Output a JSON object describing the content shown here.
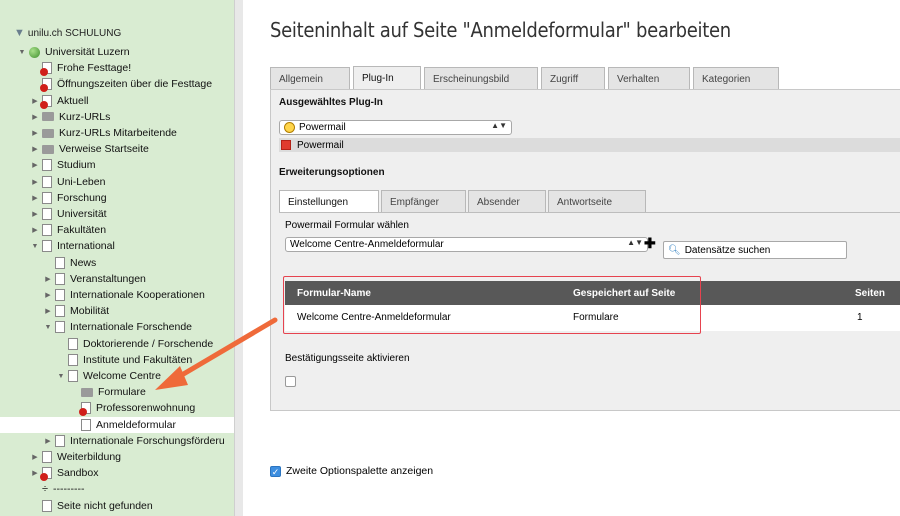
{
  "tree": {
    "site": "unilu.ch SCHULUNG",
    "items": [
      {
        "label": "Universität Luzern",
        "indent": 0,
        "icon": "globe-icon",
        "toggle": "▼"
      },
      {
        "label": "Frohe Festtage!",
        "indent": 1,
        "icon": "page-restricted-icon",
        "toggle": ""
      },
      {
        "label": "Öffnungszeiten über die Festtage",
        "indent": 1,
        "icon": "page-restricted-icon",
        "toggle": ""
      },
      {
        "label": "Aktuell",
        "indent": 1,
        "icon": "page-restricted-icon",
        "toggle": "▶"
      },
      {
        "label": "Kurz-URLs",
        "indent": 1,
        "icon": "folder-icon",
        "toggle": "▶"
      },
      {
        "label": "Kurz-URLs Mitarbeitende",
        "indent": 1,
        "icon": "folder-icon",
        "toggle": "▶"
      },
      {
        "label": "Verweise Startseite",
        "indent": 1,
        "icon": "folder-icon",
        "toggle": "▶"
      },
      {
        "label": "Studium",
        "indent": 1,
        "icon": "page-icon",
        "toggle": "▶"
      },
      {
        "label": "Uni-Leben",
        "indent": 1,
        "icon": "page-icon",
        "toggle": "▶"
      },
      {
        "label": "Forschung",
        "indent": 1,
        "icon": "page-icon",
        "toggle": "▶"
      },
      {
        "label": "Universität",
        "indent": 1,
        "icon": "page-icon",
        "toggle": "▶"
      },
      {
        "label": "Fakultäten",
        "indent": 1,
        "icon": "page-icon",
        "toggle": "▶"
      },
      {
        "label": "International",
        "indent": 1,
        "icon": "page-icon",
        "toggle": "▼"
      },
      {
        "label": "News",
        "indent": 2,
        "icon": "page-icon",
        "toggle": ""
      },
      {
        "label": "Veranstaltungen",
        "indent": 2,
        "icon": "page-icon",
        "toggle": "▶"
      },
      {
        "label": "Internationale Kooperationen",
        "indent": 2,
        "icon": "page-icon",
        "toggle": "▶"
      },
      {
        "label": "Mobilität",
        "indent": 2,
        "icon": "page-icon",
        "toggle": "▶"
      },
      {
        "label": "Internationale Forschende",
        "indent": 2,
        "icon": "page-icon",
        "toggle": "▼"
      },
      {
        "label": "Doktorierende / Forschende",
        "indent": 3,
        "icon": "page-icon",
        "toggle": ""
      },
      {
        "label": "Institute und Fakultäten",
        "indent": 3,
        "icon": "page-icon",
        "toggle": ""
      },
      {
        "label": "Welcome Centre",
        "indent": 3,
        "icon": "page-icon",
        "toggle": "▼"
      },
      {
        "label": "Formulare",
        "indent": 4,
        "icon": "folder-icon",
        "toggle": ""
      },
      {
        "label": "Professorenwohnung",
        "indent": 4,
        "icon": "page-restricted-icon",
        "toggle": ""
      },
      {
        "label": "Anmeldeformular",
        "indent": 4,
        "icon": "page-icon",
        "toggle": "",
        "selected": true
      },
      {
        "label": "Internationale Forschungsförderu",
        "indent": 2,
        "icon": "page-icon",
        "toggle": "▶"
      },
      {
        "label": "Weiterbildung",
        "indent": 1,
        "icon": "page-icon",
        "toggle": "▶"
      },
      {
        "label": "Sandbox",
        "indent": 1,
        "icon": "page-restricted-icon",
        "toggle": "▶"
      },
      {
        "label": "---------",
        "indent": 1,
        "icon": "divider-icon",
        "toggle": ""
      },
      {
        "label": "Seite nicht gefunden",
        "indent": 1,
        "icon": "page-icon",
        "toggle": ""
      }
    ]
  },
  "title": "Seiteninhalt auf Seite \"Anmeldeformular\" bearbeiten",
  "tabs": [
    "Allgemein",
    "Plug-In",
    "Erscheinungsbild",
    "Zugriff",
    "Verhalten",
    "Kategorien"
  ],
  "active_tab": 1,
  "plugin": {
    "header": "Ausgewähltes Plug-In",
    "selected": "Powermail",
    "badge": "Powermail"
  },
  "ext": {
    "header": "Erweiterungsoptionen",
    "tabs": [
      "Einstellungen",
      "Empfänger",
      "Absender",
      "Antwortseite"
    ],
    "form_label": "Powermail Formular wählen",
    "form_value": "Welcome Centre-Anmeldeformular",
    "search_label": "Datensätze suchen",
    "table": {
      "headers": [
        "Formular-Name",
        "Gespeichert auf Seite",
        "Seiten"
      ],
      "rows": [
        [
          "Welcome Centre-Anmeldeformular",
          "Formulare",
          "1"
        ]
      ]
    },
    "confirm_label": "Bestätigungsseite aktivieren"
  },
  "second_palette": "Zweite Optionspalette anzeigen",
  "colors": {
    "tree_bg": "#d9ecd2",
    "annotation": "#e6434f",
    "arrow": "#ef6a3a",
    "table_head": "#585858"
  }
}
